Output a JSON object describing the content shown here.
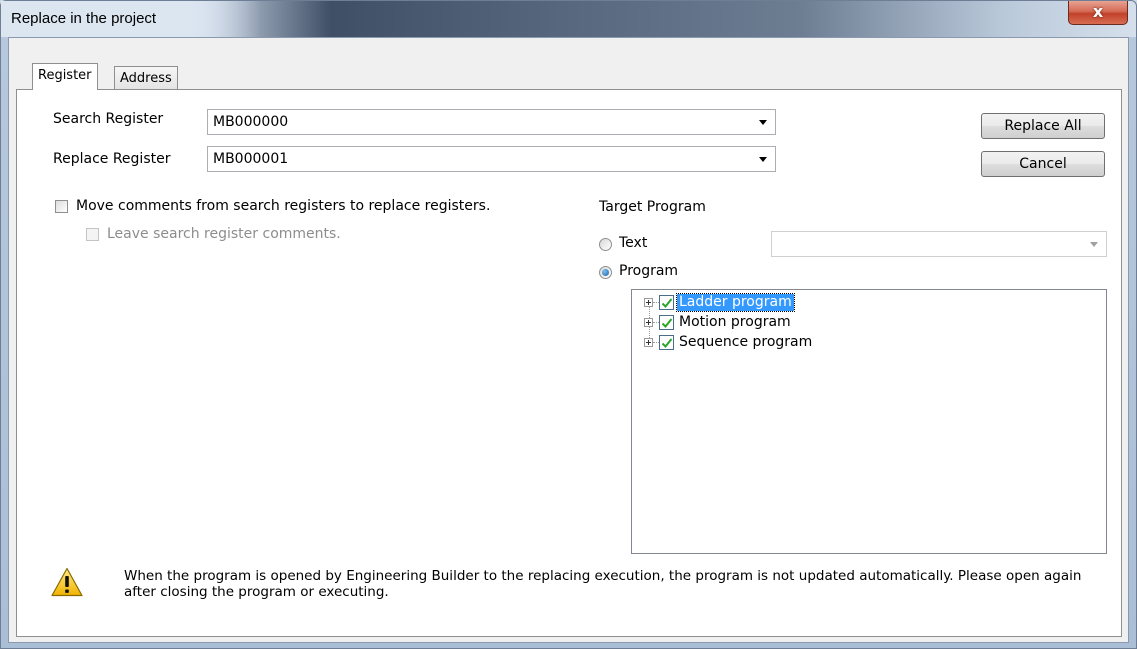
{
  "window": {
    "title": "Replace in the project",
    "close_glyph": "x"
  },
  "tabs": [
    {
      "label": "Register",
      "active": true
    },
    {
      "label": "Address",
      "active": false
    }
  ],
  "form": {
    "search_label": "Search Register",
    "search_value": "MB000000",
    "replace_label": "Replace Register",
    "replace_value": "MB000001"
  },
  "buttons": {
    "replace_all": "Replace All",
    "cancel": "Cancel"
  },
  "options": {
    "move_comments": {
      "label": "Move comments from search registers to replace registers.",
      "checked": false
    },
    "leave_comments": {
      "label": "Leave search register comments.",
      "checked": false,
      "enabled": false
    }
  },
  "target": {
    "heading": "Target Program",
    "text_radio": "Text",
    "program_radio": "Program",
    "selected": "Program",
    "text_value": ""
  },
  "tree": [
    {
      "label": "Ladder program",
      "checked": true,
      "selected": true
    },
    {
      "label": "Motion program",
      "checked": true,
      "selected": false
    },
    {
      "label": "Sequence program",
      "checked": true,
      "selected": false
    }
  ],
  "warning": {
    "icon": "warning-triangle-icon",
    "text": "When the program is opened by Engineering Builder to the replacing execution, the program is not updated automatically. Please open again after closing the program or executing."
  },
  "colors": {
    "selection": "#3399ff",
    "check": "#2aa52a",
    "close_button": "#c2412b"
  }
}
